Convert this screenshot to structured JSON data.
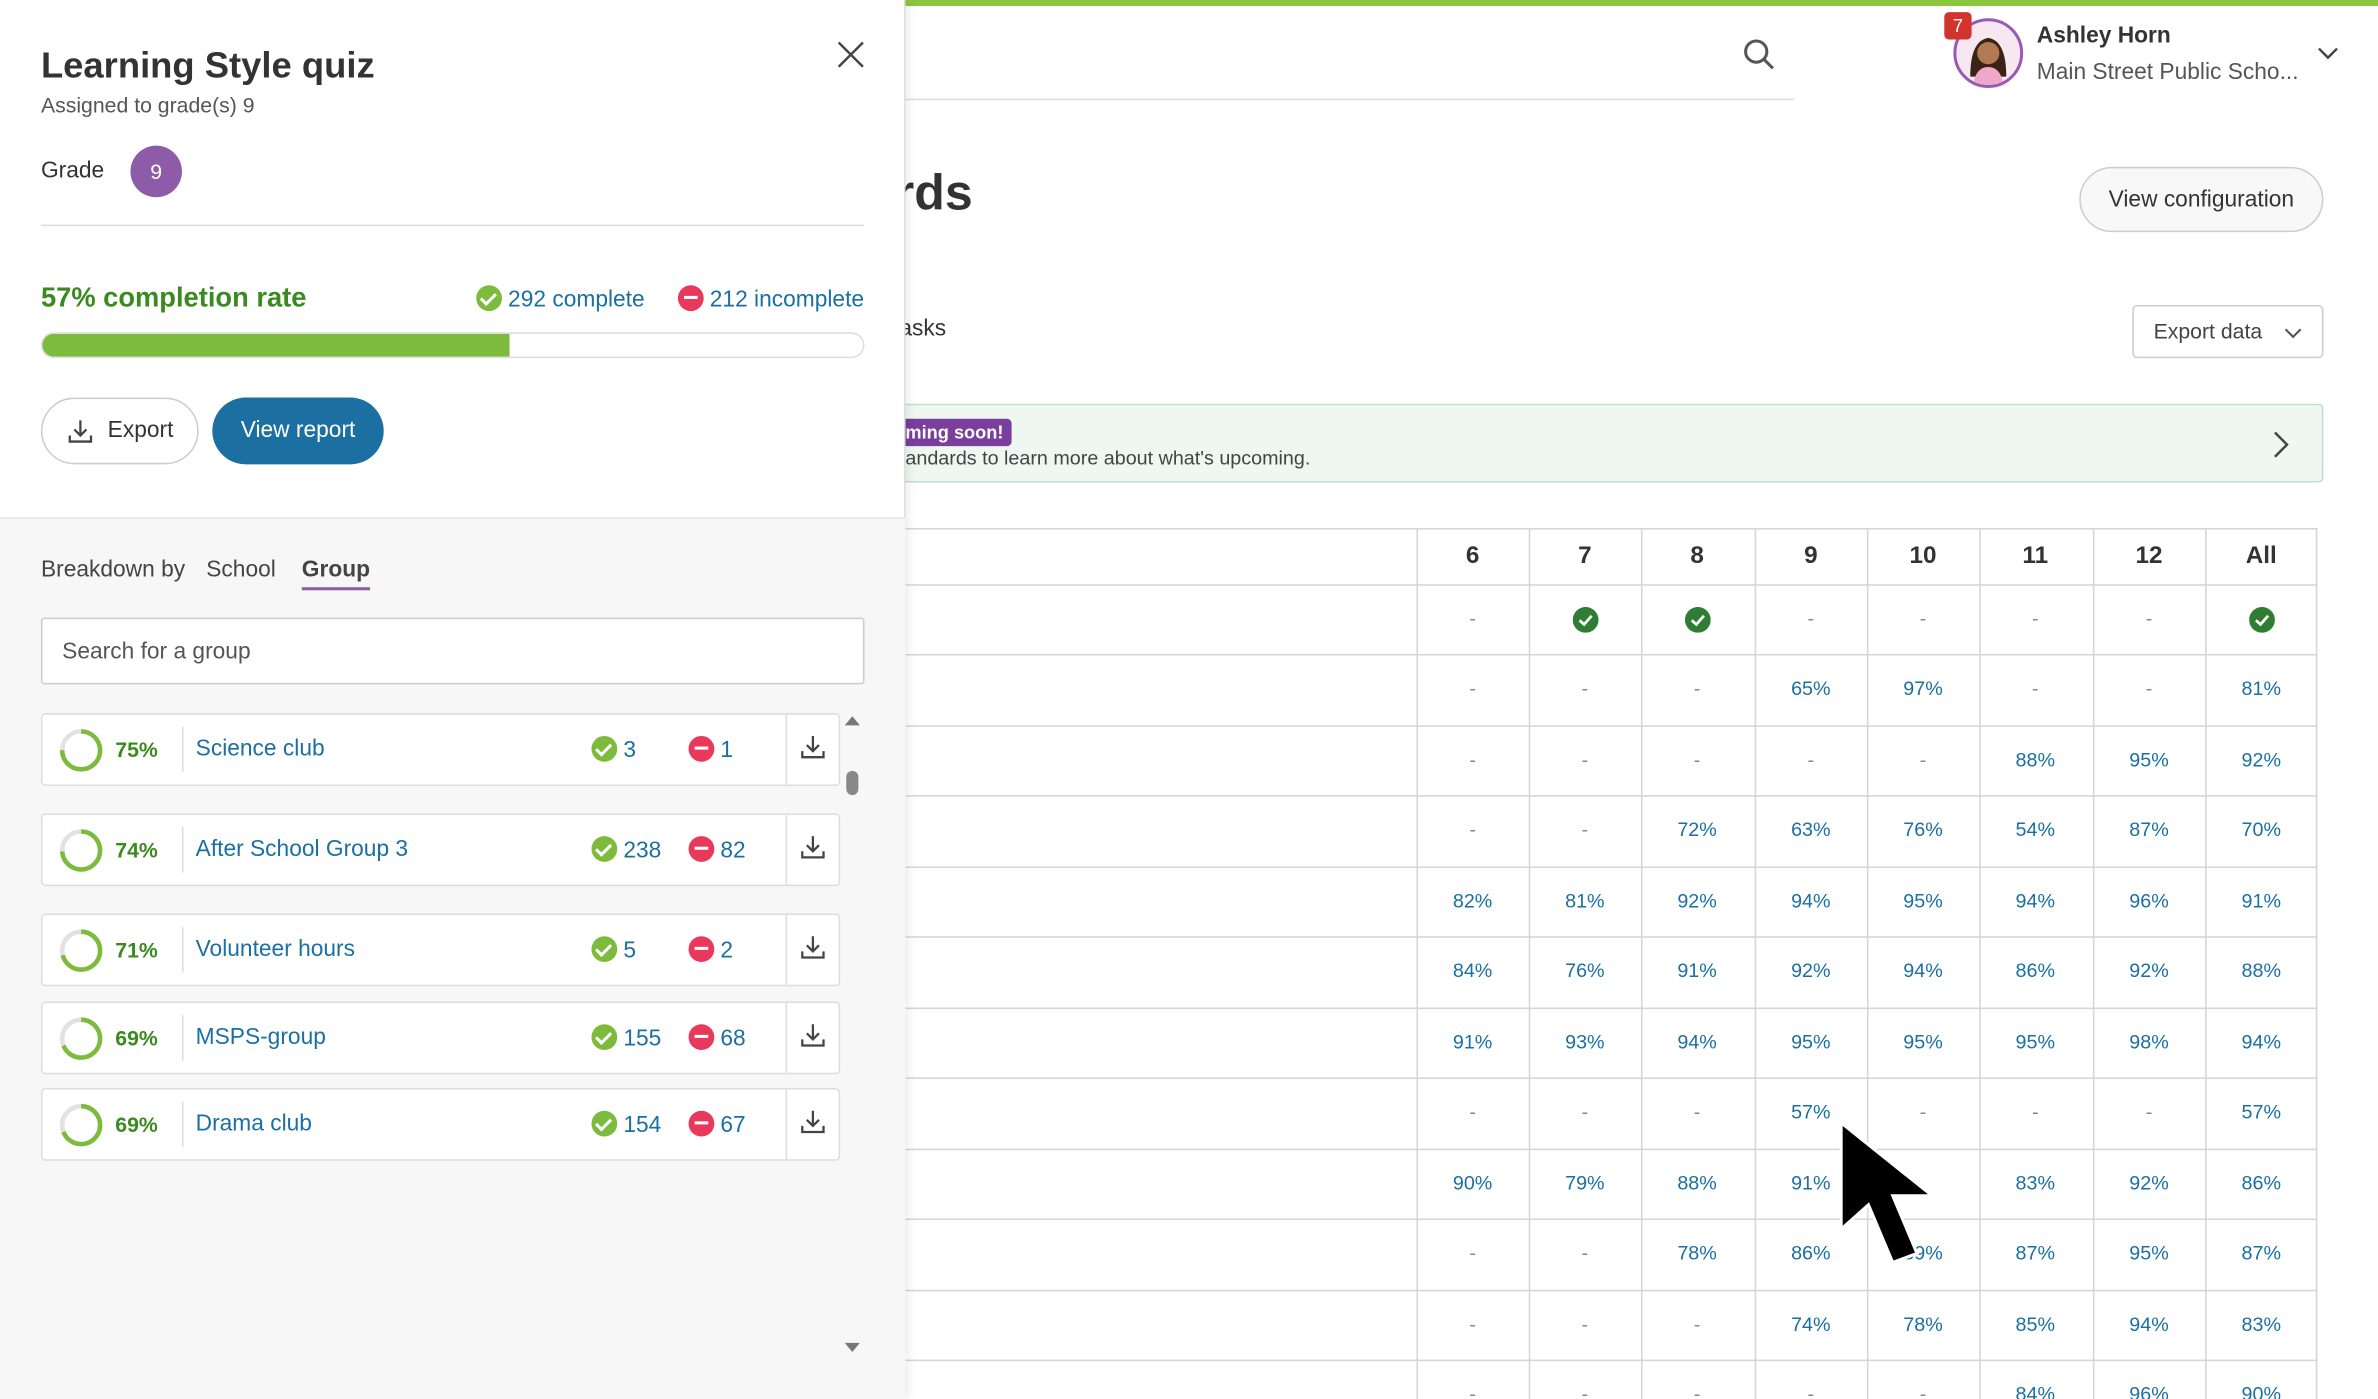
{
  "header": {
    "notification_count": "7",
    "user_name": "Ashley Horn",
    "user_school": "Main Street Public Scho...",
    "accent_color": "#8cc63f"
  },
  "page": {
    "heading_fragment": "rds",
    "view_configuration": "View configuration",
    "tasks_tab_fragment": "asks",
    "export_data": "Export data",
    "banner": {
      "badge": "ming soon!",
      "text": "andards to learn more about what's upcoming."
    }
  },
  "grid": {
    "columns": [
      "6",
      "7",
      "8",
      "9",
      "10",
      "11",
      "12",
      "All"
    ],
    "rows": [
      [
        "-",
        "check",
        "check",
        "-",
        "-",
        "-",
        "-",
        "check"
      ],
      [
        "-",
        "-",
        "-",
        "65%",
        "97%",
        "-",
        "-",
        "81%"
      ],
      [
        "-",
        "-",
        "-",
        "-",
        "-",
        "88%",
        "95%",
        "92%"
      ],
      [
        "-",
        "-",
        "72%",
        "63%",
        "76%",
        "54%",
        "87%",
        "70%"
      ],
      [
        "82%",
        "81%",
        "92%",
        "94%",
        "95%",
        "94%",
        "96%",
        "91%"
      ],
      [
        "84%",
        "76%",
        "91%",
        "92%",
        "94%",
        "86%",
        "92%",
        "88%"
      ],
      [
        "91%",
        "93%",
        "94%",
        "95%",
        "95%",
        "95%",
        "98%",
        "94%"
      ],
      [
        "-",
        "-",
        "-",
        "57%",
        "-",
        "-",
        "-",
        "57%"
      ],
      [
        "90%",
        "79%",
        "88%",
        "91%",
        "",
        "83%",
        "92%",
        "86%"
      ],
      [
        "-",
        "-",
        "78%",
        "86%",
        "89%",
        "87%",
        "95%",
        "87%"
      ],
      [
        "-",
        "-",
        "-",
        "74%",
        "78%",
        "85%",
        "94%",
        "83%"
      ],
      [
        "-",
        "-",
        "-",
        "-",
        "-",
        "84%",
        "96%",
        "90%"
      ]
    ]
  },
  "panel": {
    "title": "Learning Style quiz",
    "subtitle": "Assigned to grade(s) 9",
    "grade_label": "Grade",
    "grade_value": "9",
    "completion_rate": "57% completion rate",
    "completion_fraction": 0.57,
    "complete_count": "292 complete",
    "incomplete_count": "212 incomplete",
    "export_label": "Export",
    "view_report_label": "View report",
    "breakdown_label": "Breakdown by",
    "tab_school": "School",
    "tab_group": "Group",
    "search_placeholder": "Search for a group",
    "groups": [
      {
        "pct": "75%",
        "fraction": 0.75,
        "name": "Science club",
        "complete": "3",
        "incomplete": "1"
      },
      {
        "pct": "74%",
        "fraction": 0.74,
        "name": "After School Group 3",
        "complete": "238",
        "incomplete": "82"
      },
      {
        "pct": "71%",
        "fraction": 0.71,
        "name": "Volunteer hours",
        "complete": "5",
        "incomplete": "2"
      },
      {
        "pct": "69%",
        "fraction": 0.69,
        "name": "MSPS-group",
        "complete": "155",
        "incomplete": "68"
      },
      {
        "pct": "69%",
        "fraction": 0.69,
        "name": "Drama club",
        "complete": "154",
        "incomplete": "67"
      }
    ]
  }
}
